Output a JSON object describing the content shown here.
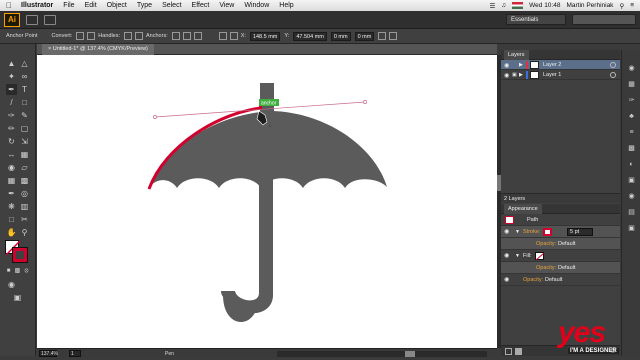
{
  "menubar": {
    "app_name": "Illustrator",
    "items": [
      "File",
      "Edit",
      "Object",
      "Type",
      "Select",
      "Effect",
      "View",
      "Window",
      "Help"
    ],
    "clock": "Wed 10:48",
    "user": "Martin Perhiniak"
  },
  "appbar": {
    "logo": "Ai",
    "workspace": "Essentials"
  },
  "controlbar": {
    "selection_label": "Anchor Point",
    "convert_label": "Convert:",
    "handles_label": "Handles:",
    "anchors_label": "Anchors:",
    "x_label": "X:",
    "x_value": "148.5 mm",
    "y_label": "Y:",
    "y_value": "47.504 mm",
    "w_value": "0 mm",
    "h_value": "0 mm"
  },
  "document": {
    "tab_title": "Untitled-1* @ 137.4% (CMYK/Preview)",
    "anchor_tooltip": "anchor",
    "path_color": "#5b5b5b",
    "selected_stroke_color": "#d2002d"
  },
  "statusbar": {
    "zoom": "137.4%",
    "page": "1",
    "tool": "Pen"
  },
  "layers": {
    "title": "Layers",
    "rows": [
      {
        "name": "Layer 2",
        "color": "#e0304a",
        "selected": true
      },
      {
        "name": "Layer 1",
        "color": "#3a6fe0",
        "selected": false
      }
    ],
    "count": "2 Layers"
  },
  "appearance": {
    "title": "Appearance",
    "object_type": "Path",
    "stroke_label": "Stroke:",
    "stroke_weight": "5 pt",
    "opacity_label": "Opacity:",
    "opacity_value": "Default",
    "fill_label": "Fill:",
    "fill_opacity_label": "Opacity:",
    "fill_opacity_value": "Default",
    "bottom_opacity_label": "Opacity:",
    "bottom_opacity_value": "Default"
  },
  "watermark": {
    "brand": "yes",
    "tagline": "I'M A DESIGNER"
  }
}
